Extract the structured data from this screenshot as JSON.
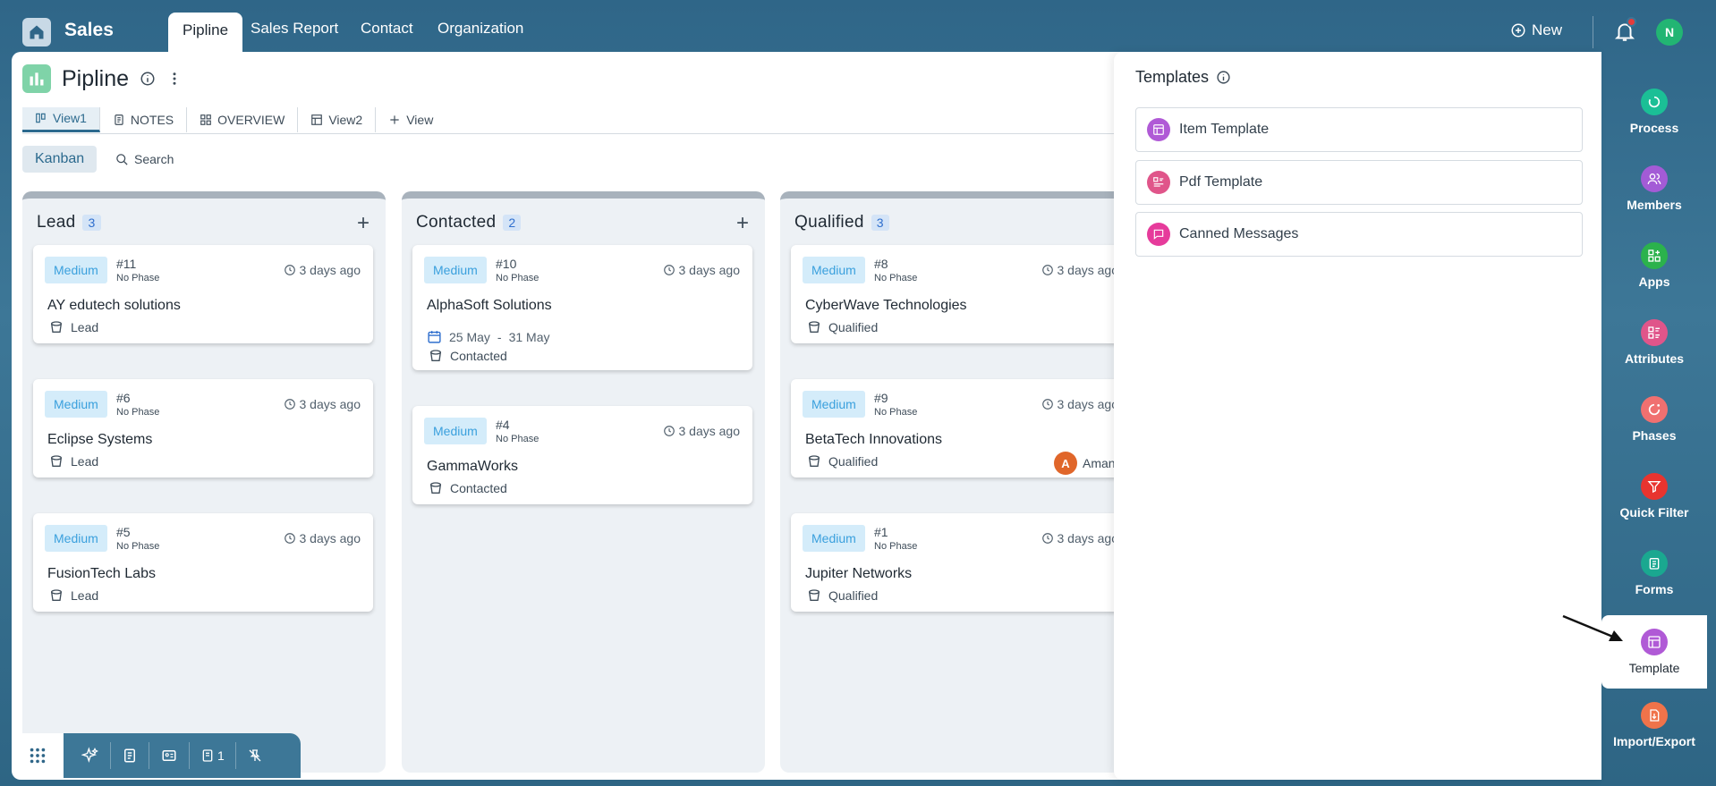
{
  "app": {
    "title": "Sales",
    "nav_tabs": [
      "Pipline",
      "Sales Report",
      "Contact",
      "Organization"
    ],
    "active_tab": "Pipline",
    "new_label": "New",
    "user_initial": "N"
  },
  "page": {
    "title": "Pipline",
    "view_tabs": [
      "View1",
      "NOTES",
      "OVERVIEW",
      "View2",
      "View"
    ],
    "kanban_label": "Kanban",
    "search_label": "Search"
  },
  "columns": [
    {
      "title": "Lead",
      "count": "3",
      "cards": [
        {
          "priority": "Medium",
          "id": "#11",
          "phase": "No Phase",
          "time": "3 days ago",
          "name": "AY edutech solutions",
          "stage": "Lead"
        },
        {
          "priority": "Medium",
          "id": "#6",
          "phase": "No Phase",
          "time": "3 days ago",
          "name": "Eclipse Systems",
          "stage": "Lead"
        },
        {
          "priority": "Medium",
          "id": "#5",
          "phase": "No Phase",
          "time": "3 days ago",
          "name": "FusionTech Labs",
          "stage": "Lead"
        }
      ]
    },
    {
      "title": "Contacted",
      "count": "2",
      "cards": [
        {
          "priority": "Medium",
          "id": "#10",
          "phase": "No Phase",
          "time": "3 days ago",
          "name": "AlphaSoft Solutions",
          "date_start": "25 May",
          "date_sep": "-",
          "date_end": "31 May",
          "stage": "Contacted"
        },
        {
          "priority": "Medium",
          "id": "#4",
          "phase": "No Phase",
          "time": "3 days ago",
          "name": "GammaWorks",
          "stage": "Contacted"
        }
      ]
    },
    {
      "title": "Qualified",
      "count": "3",
      "cards": [
        {
          "priority": "Medium",
          "id": "#8",
          "phase": "No Phase",
          "time": "3 days ago",
          "name": "CyberWave Technologies",
          "stage": "Qualified"
        },
        {
          "priority": "Medium",
          "id": "#9",
          "phase": "No Phase",
          "time": "3 days ago",
          "name": "BetaTech Innovations",
          "stage": "Qualified",
          "assignee_initial": "A",
          "assignee_name": "Aman"
        },
        {
          "priority": "Medium",
          "id": "#1",
          "phase": "No Phase",
          "time": "3 days ago",
          "name": "Jupiter Networks",
          "stage": "Qualified"
        }
      ]
    }
  ],
  "templates_panel": {
    "title": "Templates",
    "items": [
      {
        "label": "Item Template",
        "icon": "item-template-icon",
        "color": "#b05ad6"
      },
      {
        "label": "Pdf Template",
        "icon": "pdf-template-icon",
        "color": "#e0558a"
      },
      {
        "label": "Canned Messages",
        "icon": "canned-messages-icon",
        "color": "#e63b9b"
      }
    ]
  },
  "right_sidebar": [
    {
      "label": "Process",
      "icon": "process-icon",
      "color": "#1bbf96"
    },
    {
      "label": "Members",
      "icon": "members-icon",
      "color": "#a35bd6"
    },
    {
      "label": "Apps",
      "icon": "apps-icon",
      "color": "#2bb24c"
    },
    {
      "label": "Attributes",
      "icon": "attributes-icon",
      "color": "#e0558a"
    },
    {
      "label": "Phases",
      "icon": "phases-icon",
      "color": "#f07070"
    },
    {
      "label": "Quick Filter",
      "icon": "filter-icon",
      "color": "#e8342f"
    },
    {
      "label": "Forms",
      "icon": "forms-icon",
      "color": "#1aa890"
    },
    {
      "label": "Template",
      "icon": "template-icon",
      "color": "#b05ad6"
    },
    {
      "label": "Import/Export",
      "icon": "import-export-icon",
      "color": "#f0734a"
    }
  ],
  "bottom_toolbar": {
    "pages_count": "1"
  }
}
